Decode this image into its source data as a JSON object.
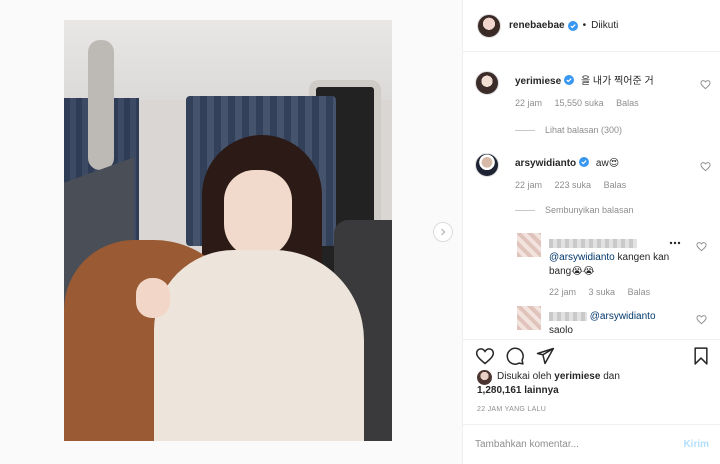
{
  "post": {
    "author": "renebaebae",
    "follow_status": "Diikuti",
    "separator": "•"
  },
  "comments": [
    {
      "username": "yerimiese",
      "text": "을 내가 찍어준 거",
      "time": "22 jam",
      "likes": "15,550 suka",
      "reply": "Balas",
      "replies_link": "Lihat balasan (300)"
    },
    {
      "username": "arsywidianto",
      "text": "aw😍",
      "time": "22 jam",
      "likes": "223 suka",
      "reply": "Balas",
      "replies_link": "Sembunyikan balasan"
    }
  ],
  "replies": [
    {
      "mention": "@arsywidianto",
      "text": "kangen kan bang😭😭",
      "time": "22 jam",
      "likes": "3 suka",
      "reply": "Balas"
    },
    {
      "mention": "@arsywidianto",
      "text": "saolo"
    }
  ],
  "likes": {
    "prefix": "Disukai oleh",
    "user": "yerimiese",
    "suffix": "dan",
    "count": "1,280,161 lainnya"
  },
  "timestamp": "22 JAM YANG LALU",
  "add_comment": {
    "placeholder": "Tambahkan komentar...",
    "post_label": "Kirim"
  },
  "colors": {
    "verified": "#3897f0",
    "link": "#00376b",
    "muted": "#8e8e8e"
  }
}
